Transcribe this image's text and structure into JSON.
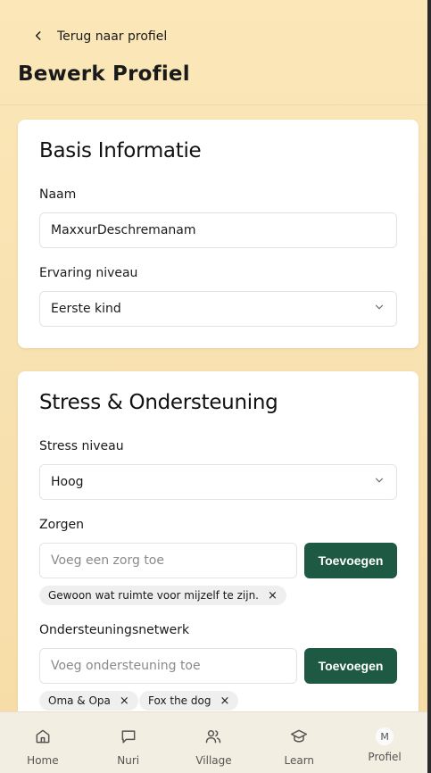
{
  "header": {
    "back_label": "Terug naar profiel",
    "page_title": "Bewerk Profiel"
  },
  "basic_info": {
    "title": "Basis Informatie",
    "name_label": "Naam",
    "name_value": "MaxxurDeschremanam",
    "experience_label": "Ervaring niveau",
    "experience_value": "Eerste kind"
  },
  "stress_support": {
    "title": "Stress & Ondersteuning",
    "stress_label": "Stress niveau",
    "stress_value": "Hoog",
    "concerns_label": "Zorgen",
    "concerns_placeholder": "Voeg een zorg toe",
    "add_button": "Toevoegen",
    "concerns": [
      "Gewoon wat ruimte voor mijzelf te zijn."
    ],
    "network_label": "Ondersteuningsnetwerk",
    "network_placeholder": "Voeg ondersteuning toe",
    "network": [
      "Oma & Opa",
      "Fox the dog"
    ]
  },
  "nav": {
    "items": [
      {
        "label": "Home",
        "icon": "home-icon"
      },
      {
        "label": "Nuri",
        "icon": "chat-icon"
      },
      {
        "label": "Village",
        "icon": "users-icon"
      },
      {
        "label": "Learn",
        "icon": "graduation-cap-icon"
      },
      {
        "label": "Profiel",
        "icon": "avatar",
        "avatar_letter": "M"
      }
    ]
  },
  "colors": {
    "accent": "#1e5a43",
    "background_top": "#fbe7b8",
    "nav_background": "#f3eee2"
  }
}
